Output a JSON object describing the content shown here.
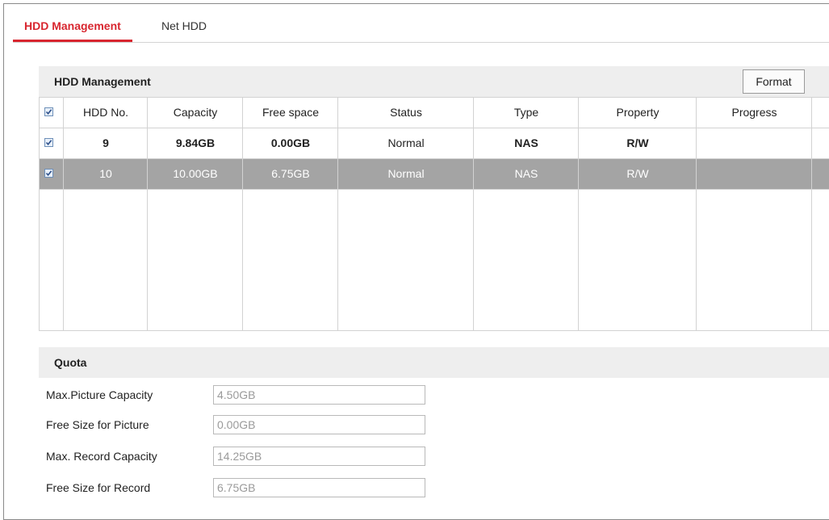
{
  "tabs": [
    {
      "label": "HDD Management",
      "active": true
    },
    {
      "label": "Net HDD",
      "active": false
    }
  ],
  "hdd_section": {
    "title": "HDD Management",
    "format_label": "Format",
    "columns": [
      "HDD No.",
      "Capacity",
      "Free space",
      "Status",
      "Type",
      "Property",
      "Progress"
    ],
    "rows": [
      {
        "checked": true,
        "selected": false,
        "hdd_no": "9",
        "capacity": "9.84GB",
        "free_space": "0.00GB",
        "status": "Normal",
        "type": "NAS",
        "property": "R/W",
        "progress": ""
      },
      {
        "checked": true,
        "selected": true,
        "hdd_no": "10",
        "capacity": "10.00GB",
        "free_space": "6.75GB",
        "status": "Normal",
        "type": "NAS",
        "property": "R/W",
        "progress": ""
      }
    ]
  },
  "quota": {
    "title": "Quota",
    "fields": [
      {
        "label": "Max.Picture Capacity",
        "value": "4.50GB"
      },
      {
        "label": "Free Size for Picture",
        "value": "0.00GB"
      },
      {
        "label": "Max. Record Capacity",
        "value": "14.25GB"
      },
      {
        "label": "Free Size for Record",
        "value": "6.75GB"
      }
    ]
  },
  "colors": {
    "accent": "#d8262f",
    "selected_row": "#a4a4a4",
    "header_bg": "#eeeeee"
  }
}
